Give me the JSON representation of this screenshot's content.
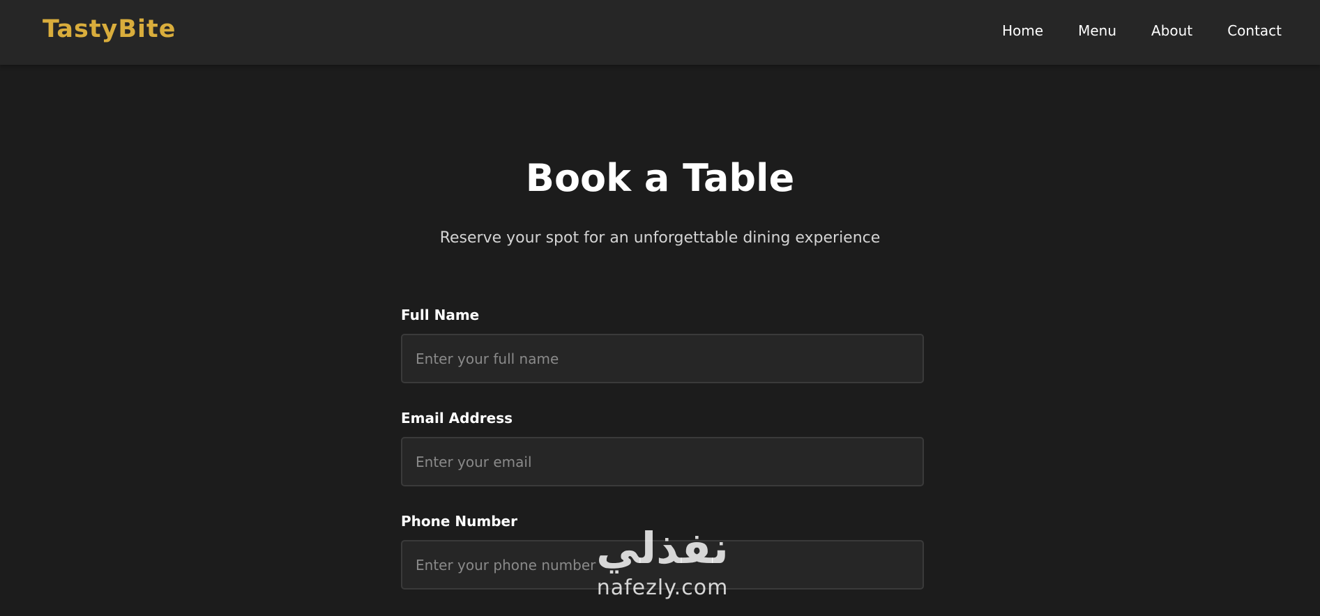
{
  "header": {
    "logo": "TastyBite",
    "nav": [
      "Home",
      "Menu",
      "About",
      "Contact"
    ]
  },
  "hero": {
    "title": "Book a Table",
    "subtitle": "Reserve your spot for an unforgettable dining experience"
  },
  "form": {
    "fields": [
      {
        "label": "Full Name",
        "placeholder": "Enter your full name"
      },
      {
        "label": "Email Address",
        "placeholder": "Enter your email"
      },
      {
        "label": "Phone Number",
        "placeholder": "Enter your phone number"
      }
    ]
  },
  "watermark": {
    "arabic": "نفذلي",
    "latin": "nafezly.com"
  },
  "colors": {
    "background": "#1c1c1c",
    "navbar": "#262626",
    "accent": "#d9ad3c",
    "input_bg": "#262626",
    "input_border": "#3a3a3a"
  }
}
